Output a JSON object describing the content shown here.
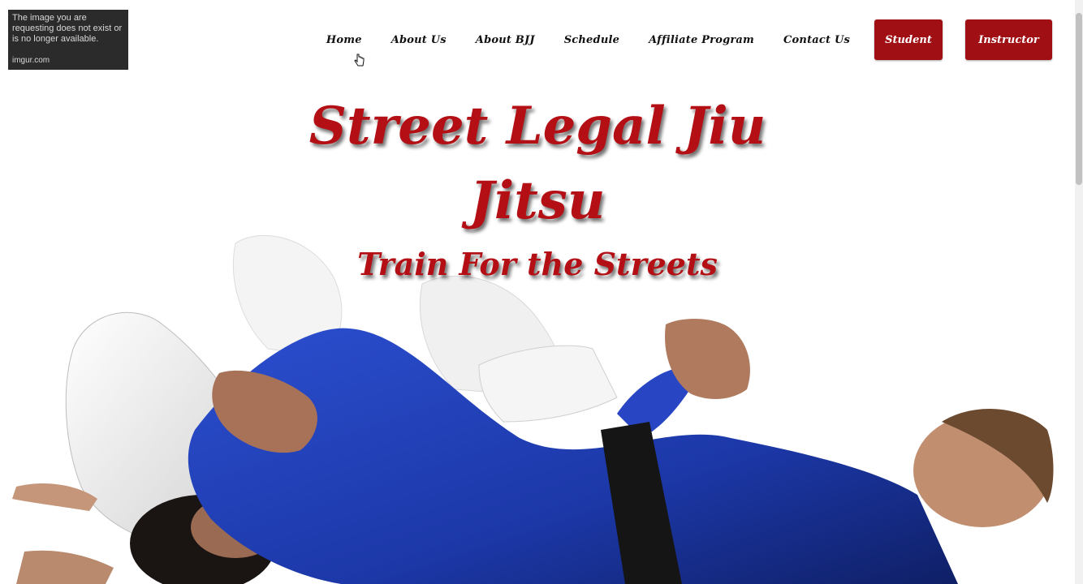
{
  "logo": {
    "message": "The image you are requesting does not exist or is no longer available.",
    "source": "imgur.com"
  },
  "nav": {
    "links": [
      "Home",
      "About Us",
      "About BJJ",
      "Schedule",
      "Affiliate Program",
      "Contact Us"
    ],
    "student_label": "Student",
    "instructor_label": "Instructor"
  },
  "hero": {
    "title_line1": "Street Legal Jiu",
    "title_line2": "Jitsu",
    "subtitle": "Train For the Streets"
  },
  "colors": {
    "brand_red": "#a00f14",
    "title_red": "#b30f14",
    "gi_blue": "#1f3fb0",
    "gi_white": "#f2f2f2"
  },
  "icons": {
    "cursor": "hand-pointer-icon"
  }
}
